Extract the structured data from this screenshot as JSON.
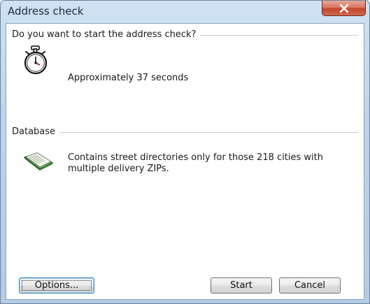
{
  "window": {
    "title": "Address check"
  },
  "timing": {
    "question": "Do you want to start the address check?",
    "estimate": "Approximately 37 seconds",
    "icon": "stopwatch-icon"
  },
  "database": {
    "heading": "Database",
    "description_line1": "Contains street directories only for those 218 cities with",
    "description_line2": "multiple delivery ZIPs.",
    "icon": "book-icon"
  },
  "buttons": {
    "options": "Options...",
    "start": "Start",
    "cancel": "Cancel"
  },
  "colors": {
    "close_button": "#c1452a",
    "titlebar": "#bcd4ec"
  }
}
